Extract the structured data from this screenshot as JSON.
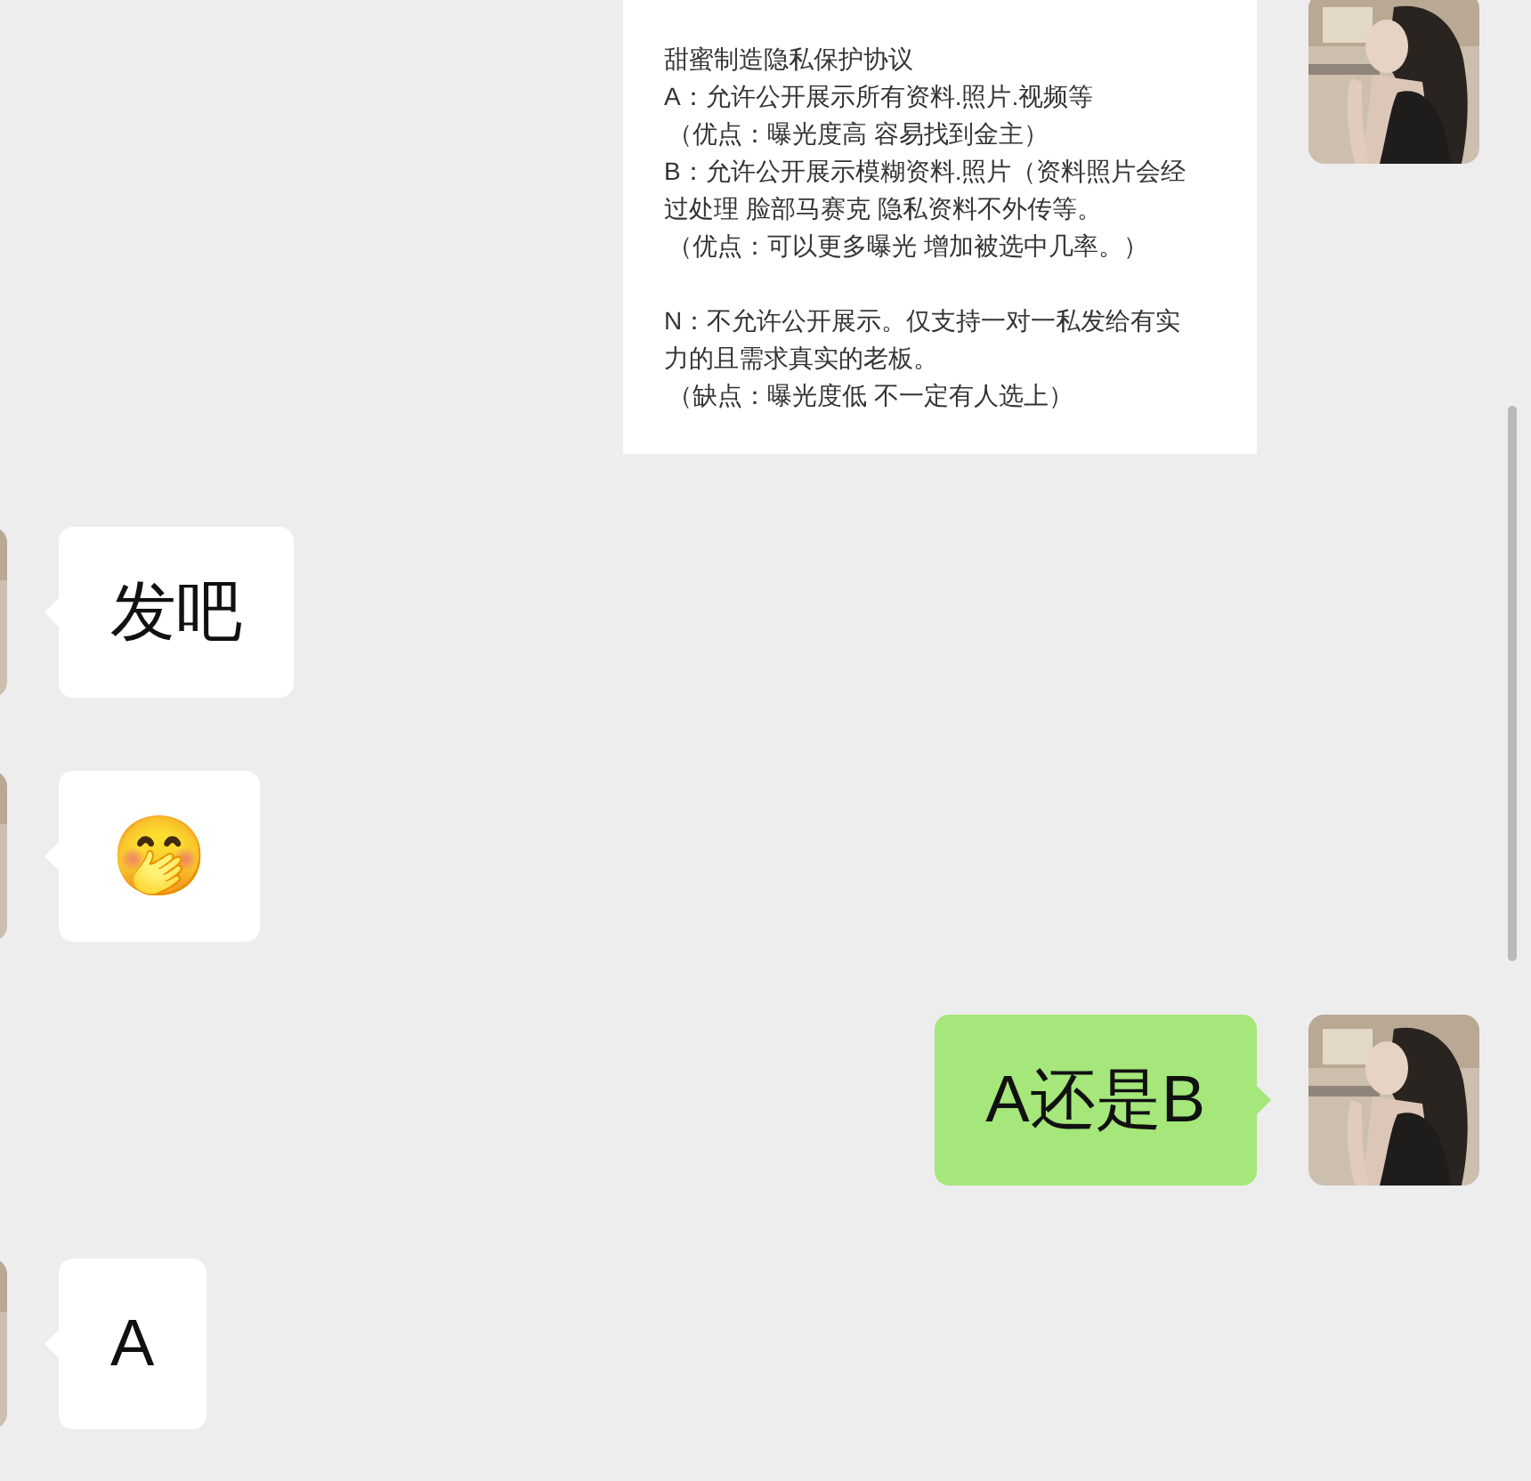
{
  "messages": [
    {
      "outgoing": true,
      "kind": "document",
      "lines": [
        {
          "text": "甜蜜制造隐私保护协议",
          "indent": false,
          "gap_before": false
        },
        {
          "text": "A：允许公开展示所有资料.照片.视频等",
          "indent": false,
          "gap_before": false
        },
        {
          "text": "（优点：曝光度高 容易找到金主）",
          "indent": true,
          "gap_before": false
        },
        {
          "text": "B：允许公开展示模糊资料.照片（资料照片会经过处理 脸部马赛克 隐私资料不外传等。",
          "indent": false,
          "gap_before": false
        },
        {
          "text": "（优点：可以更多曝光 增加被选中几率。）",
          "indent": true,
          "gap_before": false
        },
        {
          "text": "N：不允许公开展示。仅支持一对一私发给有实力的且需求真实的老板。",
          "indent": false,
          "gap_before": true
        },
        {
          "text": "（缺点：曝光度低 不一定有人选上）",
          "indent": true,
          "gap_before": false
        }
      ]
    },
    {
      "outgoing": false,
      "kind": "text",
      "text": "发吧"
    },
    {
      "outgoing": false,
      "kind": "emoji",
      "text": "🤭"
    },
    {
      "outgoing": true,
      "kind": "text",
      "text": "A还是B"
    },
    {
      "outgoing": false,
      "kind": "text",
      "text": "A"
    }
  ]
}
